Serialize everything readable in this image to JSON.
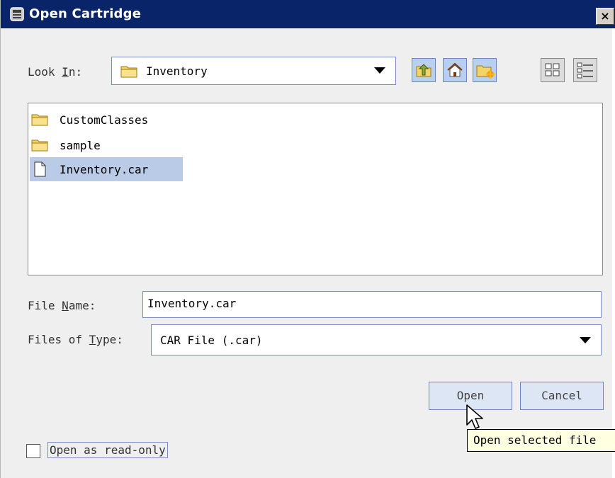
{
  "window": {
    "title": "Open Cartridge",
    "close_label": "×"
  },
  "look_in": {
    "label_pre": "Look ",
    "label_mnemonic": "I",
    "label_post": "n:",
    "value": "Inventory"
  },
  "toolbar": {
    "icons": [
      "up-folder-icon",
      "home-icon",
      "new-folder-icon",
      "list-view-icon",
      "details-view-icon"
    ]
  },
  "files": [
    {
      "name": "CustomClasses",
      "type": "folder",
      "selected": false
    },
    {
      "name": "sample",
      "type": "folder",
      "selected": false
    },
    {
      "name": "Inventory.car",
      "type": "file",
      "selected": true
    }
  ],
  "file_name": {
    "label_pre": "File ",
    "label_mnemonic": "N",
    "label_post": "ame:",
    "value": "Inventory.car"
  },
  "files_of_type": {
    "label_pre": "Files of ",
    "label_mnemonic": "T",
    "label_post": "ype:",
    "value": "CAR File (.car)"
  },
  "buttons": {
    "open": "Open",
    "cancel": "Cancel"
  },
  "options": {
    "read_only_label": "Open as read-only",
    "read_only_checked": false
  },
  "tooltip": "Open selected file",
  "colors": {
    "titlebar": "#0a246a",
    "accent_border": "#6c86c0",
    "selection": "#b9cbe6"
  }
}
